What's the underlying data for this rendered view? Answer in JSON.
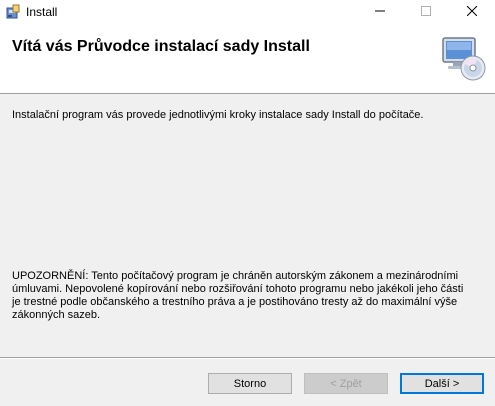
{
  "window": {
    "title": "Install"
  },
  "icons": {
    "app": "installer-icon",
    "minimize": "minimize-icon",
    "maximize": "maximize-icon",
    "close": "close-icon",
    "banner": "computer-cd-icon"
  },
  "banner": {
    "title": "Vítá vás Průvodce instalací sady Install"
  },
  "body": {
    "intro": "Instalační program vás provede jednotlivými kroky instalace sady Install do počítače.",
    "warning": "UPOZORNĚNÍ: Tento počítačový program je chráněn autorským zákonem a mezinárodními úmluvami. Nepovolené kopírování nebo rozšiřování tohoto programu nebo jakékoli jeho části je trestné podle občanského a trestního práva a je postihováno tresty až do maximální výše zákonných sazeb."
  },
  "buttons": {
    "cancel": "Storno",
    "back": "< Zpět",
    "next": "Další >"
  },
  "colors": {
    "accent": "#0078d7",
    "face": "#f0f0f0"
  }
}
